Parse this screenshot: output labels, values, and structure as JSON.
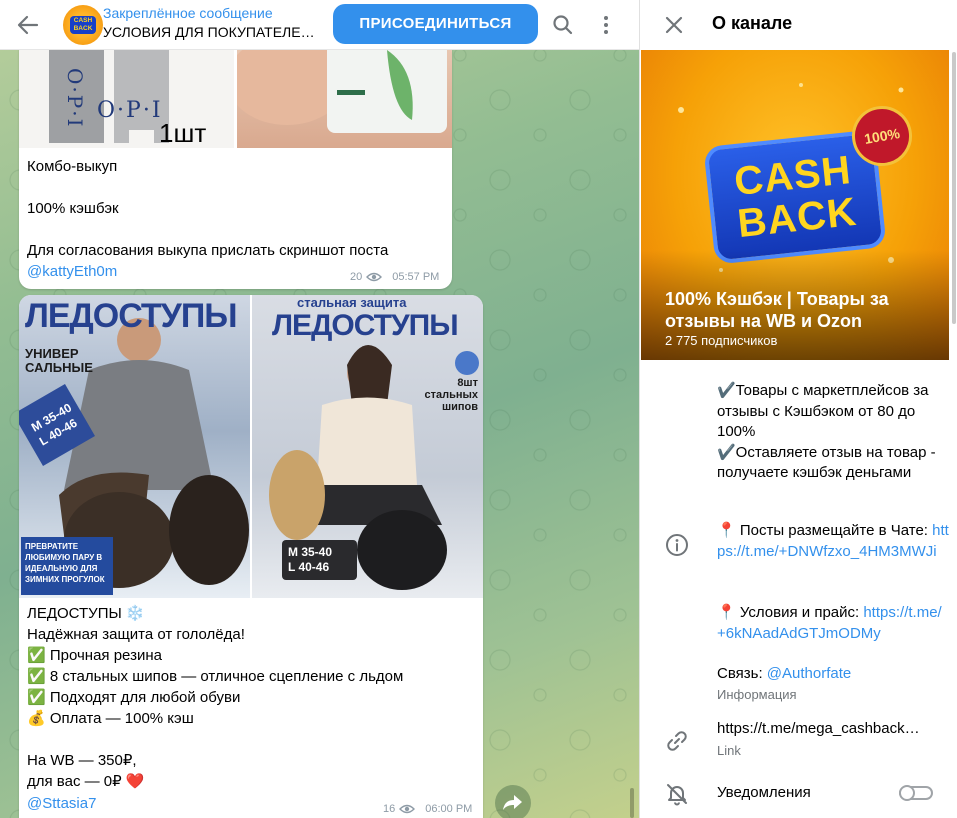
{
  "header": {
    "pinned_title": "Закреплённое сообщение",
    "pinned_text": "УСЛОВИЯ ДЛЯ ПОКУПАТЕЛЕЙ ...",
    "join_label": "ПРИСОЕДИНИТЬСЯ"
  },
  "messages": [
    {
      "text": "Комбо-выкуп\n\n100% кэшбэк\n\nДля согласования выкупа прислать скриншот поста",
      "author_link": "@kattyEth0m",
      "views": "20",
      "time": "05:57 PM",
      "image_texts": {
        "brand": "O·P·I",
        "count": "1шт"
      }
    },
    {
      "text": "ЛЕДОСТУПЫ ❄️\nНадёжная защита от гололёда!\n✅ Прочная резина\n✅ 8 стальных шипов — отличное сцепление с льдом\n✅ Подходят для любой обуви\n💰 Оплата — 100% кэш\n\nНа WB — 350₽,\nдля вас — 0₽ ❤️",
      "author_link": "@Sttasia7",
      "views": "16",
      "time": "06:00 PM",
      "image_texts": {
        "left_title": "ЛЕДОСТУПЫ",
        "left_sub": "УНИВЕР САЛЬНЫЕ",
        "left_sizes": "M 35-40 L 40-46",
        "left_promo": "ПРЕВРАТИТЕ ЛЮБИМУЮ ПАРУ В ИДЕАЛЬНУЮ ДЛЯ ЗИМНИХ ПРОГУЛОК",
        "right_top": "стальная защита",
        "right_title": "ЛЕДОСТУПЫ",
        "right_badge": "8шт стальных шипов",
        "right_sizes": "M 35-40\nL 40-46"
      }
    }
  ],
  "info": {
    "title": "О канале",
    "hero_logo_line1": "CASH",
    "hero_logo_line2": "BACK",
    "hero_badge": "100%",
    "channel_name": "100% Кэшбэк | Товары за отзывы на WB и Ozon",
    "subscribers": "2 775 подписчиков",
    "description": "✔️Товары с маркетплейсов за отзывы с Кэшбэком от 80 до 100%\n✔️Оставляете отзыв на товар - получаете кэшбэк деньгами",
    "posts_prefix": "📍 Посты размещайте в Чате: ",
    "posts_link": "https://t.me/+DNWfzxo_4HM3MWJi",
    "rules_prefix": "📍 Условия и прайс: ",
    "rules_link": "https://t.me/+6kNAadAdGTJmODMy",
    "contact_prefix": "Связь: ",
    "contact_link": "@Authorfate",
    "contact_label": "Информация",
    "channel_link": "https://t.me/mega_cashback…",
    "channel_link_label": "Link",
    "notifications_label": "Уведомления",
    "notifications_on": false
  },
  "colors": {
    "accent": "#3390ec",
    "meta": "#8e9ba6"
  }
}
